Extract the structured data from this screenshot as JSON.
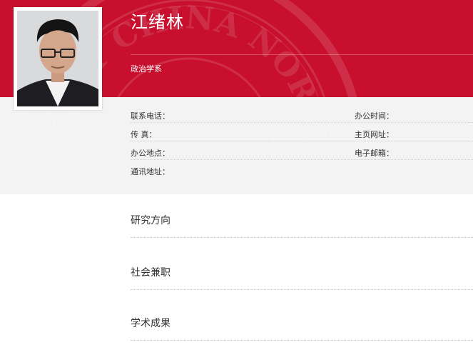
{
  "profile": {
    "name": "江绪林",
    "department": "政治学系"
  },
  "contact": {
    "phone_label": "联系电话：",
    "fax_label": "传 真：",
    "office_label": "办公地点：",
    "address_label": "通讯地址：",
    "office_hours_label": "办公时间：",
    "homepage_label": "主页网址：",
    "email_label": "电子邮箱："
  },
  "sections": {
    "research": "研究方向",
    "social": "社会兼职",
    "academic": "学术成果"
  },
  "colors": {
    "brand_red": "#c8102e",
    "info_band": "#f3f3f3"
  }
}
